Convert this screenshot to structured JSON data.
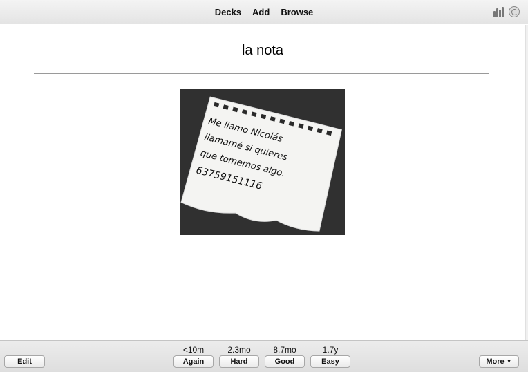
{
  "toolbar": {
    "nav": [
      "Decks",
      "Add",
      "Browse"
    ],
    "icons": [
      "stats-icon",
      "sync-icon"
    ]
  },
  "card": {
    "question": "la nota",
    "image": {
      "description_icon": "handwritten-note-image",
      "lines": [
        "Me llamo Nicolás",
        "llamamé si quieres",
        "que tomemos algo.",
        "63759151116"
      ]
    }
  },
  "bottom": {
    "edit_label": "Edit",
    "more_label": "More",
    "answers": [
      {
        "label": "Again",
        "interval": "<10m"
      },
      {
        "label": "Hard",
        "interval": "2.3mo"
      },
      {
        "label": "Good",
        "interval": "8.7mo"
      },
      {
        "label": "Easy",
        "interval": "1.7y"
      }
    ]
  }
}
